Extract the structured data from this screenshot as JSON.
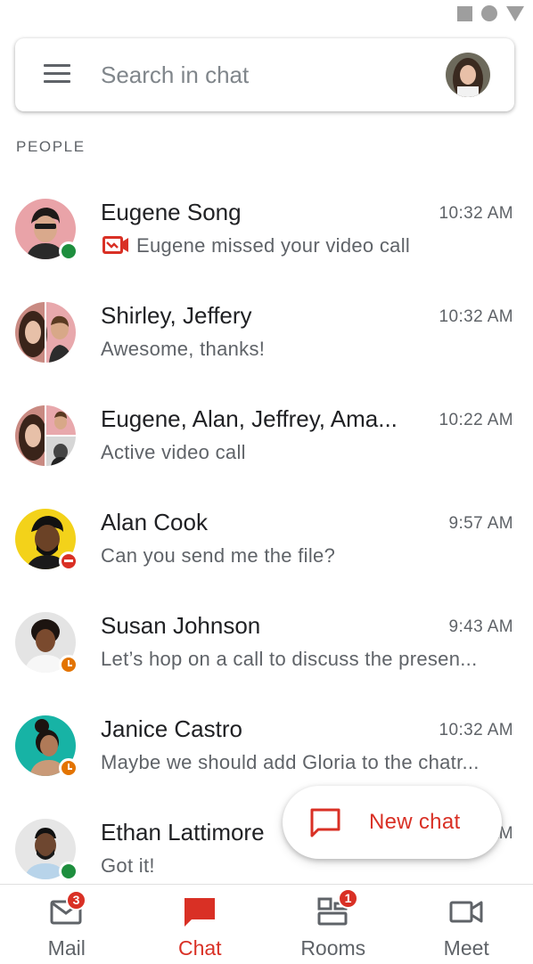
{
  "search": {
    "placeholder": "Search in chat"
  },
  "section_header": "PEOPLE",
  "conversations": [
    {
      "name": "Eugene Song",
      "time": "10:32 AM",
      "snippet": "Eugene missed your video call",
      "status": "online"
    },
    {
      "name": "Shirley, Jeffery",
      "time": "10:32 AM",
      "snippet": "Awesome, thanks!",
      "status": "none"
    },
    {
      "name": "Eugene, Alan, Jeffrey, Ama...",
      "time": "10:22 AM",
      "snippet": "Active video call",
      "status": "none"
    },
    {
      "name": "Alan Cook",
      "time": "9:57 AM",
      "snippet": "Can you send me the file?",
      "status": "do-not-disturb"
    },
    {
      "name": "Susan Johnson",
      "time": "9:43 AM",
      "snippet": "Let’s hop on a call to discuss the presen...",
      "status": "away"
    },
    {
      "name": "Janice Castro",
      "time": "10:32 AM",
      "snippet": "Maybe we should add Gloria to the chatr...",
      "status": "away"
    },
    {
      "name": "Ethan Lattimore",
      "time": "10:32 AM",
      "snippet": "Got it!",
      "status": "online"
    }
  ],
  "fab": {
    "label": "New chat"
  },
  "bottom_nav": [
    {
      "label": "Mail",
      "badge": "3"
    },
    {
      "label": "Chat",
      "badge": ""
    },
    {
      "label": "Rooms",
      "badge": "1"
    },
    {
      "label": "Meet",
      "badge": ""
    }
  ],
  "colors": {
    "accent": "#d93025",
    "online": "#1e8e3e",
    "away": "#e37400",
    "text_secondary": "#5f6368"
  }
}
